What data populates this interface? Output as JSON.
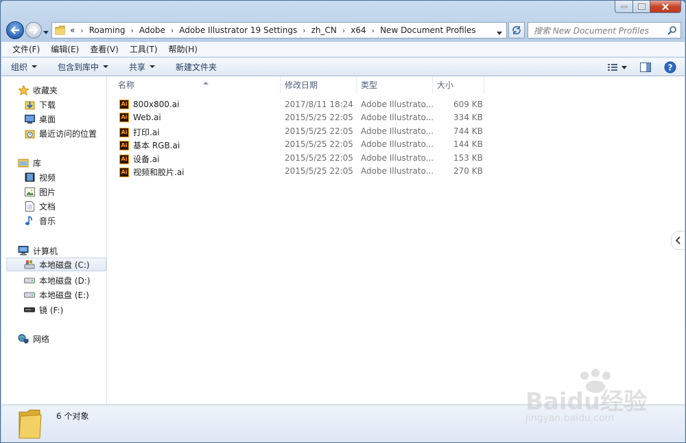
{
  "window": {
    "caption_buttons": [
      "minimize",
      "maximize",
      "close"
    ]
  },
  "navigation": {
    "breadcrumb_overflow": "«",
    "breadcrumb": [
      "Roaming",
      "Adobe",
      "Adobe Illustrator 19 Settings",
      "zh_CN",
      "x64",
      "New Document Profiles"
    ],
    "search_placeholder": "搜索 New Document Profiles"
  },
  "menubar": {
    "items": [
      "文件(F)",
      "编辑(E)",
      "查看(V)",
      "工具(T)",
      "帮助(H)"
    ]
  },
  "toolbar": {
    "organize": "组织",
    "include_in_library": "包含到库中",
    "share": "共享",
    "new_folder": "新建文件夹"
  },
  "sidebar": {
    "favorites": {
      "label": "收藏夹",
      "items": [
        "下载",
        "桌面",
        "最近访问的位置"
      ]
    },
    "libraries": {
      "label": "库",
      "items": [
        "视频",
        "图片",
        "文档",
        "音乐"
      ]
    },
    "computer": {
      "label": "计算机",
      "items": [
        "本地磁盘 (C:)",
        "本地磁盘 (D:)",
        "本地磁盘 (E:)",
        "镜 (F:)"
      ]
    },
    "network": {
      "label": "网络"
    }
  },
  "file_list": {
    "columns": [
      "名称",
      "修改日期",
      "类型",
      "大小"
    ],
    "files": [
      {
        "name": "800x800.ai",
        "date": "2017/8/11 18:24",
        "type": "Adobe Illustrato...",
        "size": "609 KB"
      },
      {
        "name": "Web.ai",
        "date": "2015/5/25 22:05",
        "type": "Adobe Illustrato...",
        "size": "334 KB"
      },
      {
        "name": "打印.ai",
        "date": "2015/5/25 22:05",
        "type": "Adobe Illustrato...",
        "size": "744 KB"
      },
      {
        "name": "基本 RGB.ai",
        "date": "2015/5/25 22:05",
        "type": "Adobe Illustrato...",
        "size": "144 KB"
      },
      {
        "name": "设备.ai",
        "date": "2015/5/25 22:05",
        "type": "Adobe Illustrato...",
        "size": "153 KB"
      },
      {
        "name": "视频和胶片.ai",
        "date": "2015/5/25 22:05",
        "type": "Adobe Illustrato...",
        "size": "270 KB"
      }
    ],
    "file_icon_text": "Ai"
  },
  "details_pane": {
    "item_count": "6 个对象"
  },
  "watermark": {
    "text": "Baidu经验",
    "url": "jingyan.baidu.com"
  },
  "colors": {
    "accent": "#1e395b",
    "ai_icon_bg": "#2b1406",
    "ai_icon_fg": "#ff9a00"
  }
}
